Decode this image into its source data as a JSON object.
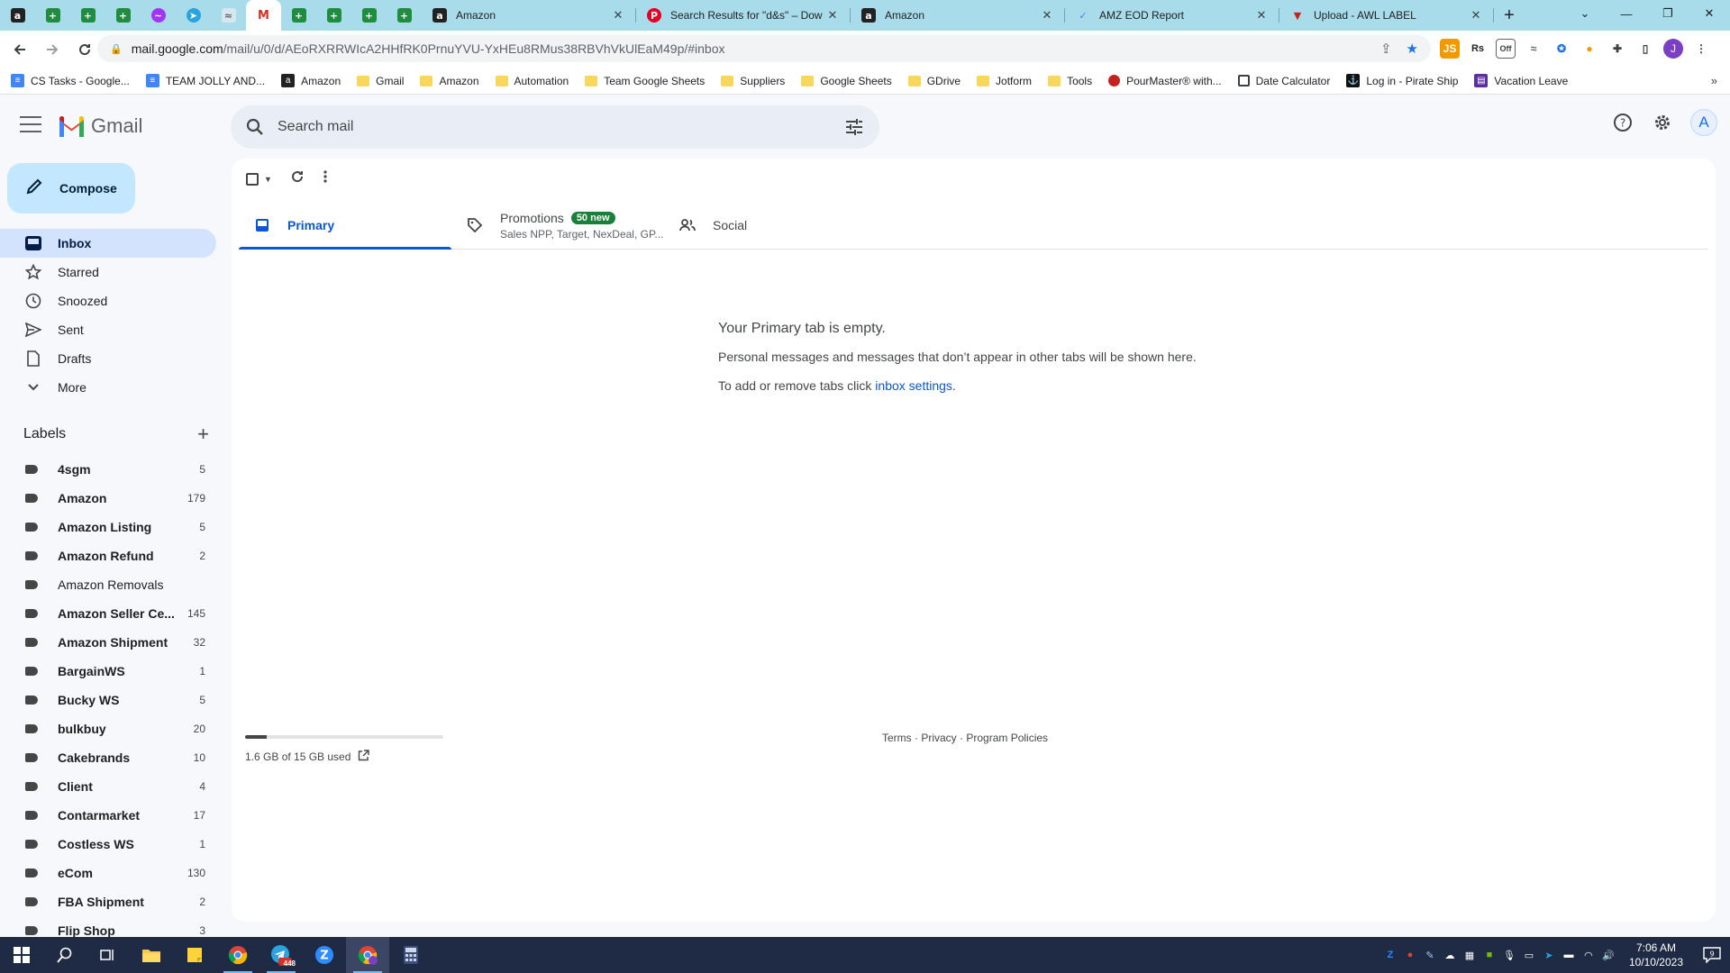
{
  "browser": {
    "pinned_tabs": [
      {
        "icon": "amazon-icon",
        "glyph": "a"
      },
      {
        "icon": "sheets-icon",
        "glyph": "+"
      },
      {
        "icon": "sheets-icon",
        "glyph": "+"
      },
      {
        "icon": "sheets-icon",
        "glyph": "+"
      },
      {
        "icon": "messenger-icon",
        "glyph": "~"
      },
      {
        "icon": "telegram-icon",
        "glyph": "➤"
      },
      {
        "icon": "misc-icon",
        "glyph": "≈"
      },
      {
        "icon": "gmail-icon",
        "glyph": "M"
      },
      {
        "icon": "sheets-icon",
        "glyph": "+"
      },
      {
        "icon": "sheets-icon",
        "glyph": "+"
      },
      {
        "icon": "sheets-icon",
        "glyph": "+"
      },
      {
        "icon": "sheets-icon",
        "glyph": "+"
      }
    ],
    "tabs": [
      {
        "title": "Amazon",
        "icon": "amazon-icon",
        "glyph": "a"
      },
      {
        "title": "Search Results for \"d&s\" – Dow",
        "icon": "pinterest-icon",
        "glyph": "P"
      },
      {
        "title": "Amazon",
        "icon": "amazon-icon",
        "glyph": "a"
      },
      {
        "title": "AMZ EOD Report",
        "icon": "report-icon",
        "glyph": "✓"
      },
      {
        "title": "Upload - AWL LABEL",
        "icon": "awl-icon",
        "glyph": "▼"
      }
    ],
    "close_glyph": "✕",
    "newtab_glyph": "+",
    "url_host": "mail.google.com",
    "url_path": "/mail/u/0/d/AEoRXRRWIcA2HHfRK0PrnuYVU-YxHEu8RMus38RBVhVkUlEaM49p/#inbox",
    "profile_initial": "J",
    "bookmarks": [
      {
        "label": "CS Tasks - Google...",
        "icon": "doc"
      },
      {
        "label": "TEAM JOLLY AND...",
        "icon": "doc"
      },
      {
        "label": "Amazon",
        "icon": "amz"
      },
      {
        "label": "Gmail",
        "icon": "folder"
      },
      {
        "label": "Amazon",
        "icon": "folder"
      },
      {
        "label": "Automation",
        "icon": "folder"
      },
      {
        "label": "Team Google Sheets",
        "icon": "folder"
      },
      {
        "label": "Suppliers",
        "icon": "folder"
      },
      {
        "label": "Google Sheets",
        "icon": "folder"
      },
      {
        "label": "GDrive",
        "icon": "folder"
      },
      {
        "label": "Jotform",
        "icon": "folder"
      },
      {
        "label": "Tools",
        "icon": "folder"
      },
      {
        "label": "PourMaster® with...",
        "icon": "red"
      },
      {
        "label": "Date Calculator",
        "icon": "cal"
      },
      {
        "label": "Log in - Pirate Ship",
        "icon": "pirate"
      },
      {
        "label": "Vacation Leave",
        "icon": "purple"
      }
    ]
  },
  "gmail": {
    "logo_text": "Gmail",
    "search_placeholder": "Search mail",
    "avatar_initial": "A",
    "compose_label": "Compose",
    "nav": [
      {
        "label": "Inbox",
        "icon": "inbox-icon",
        "active": true
      },
      {
        "label": "Starred",
        "icon": "star-icon"
      },
      {
        "label": "Snoozed",
        "icon": "clock-icon"
      },
      {
        "label": "Sent",
        "icon": "send-icon"
      },
      {
        "label": "Drafts",
        "icon": "draft-icon"
      },
      {
        "label": "More",
        "icon": "chevron-down-icon"
      }
    ],
    "labels_title": "Labels",
    "labels": [
      {
        "name": "4sgm",
        "count": "5",
        "bold": true
      },
      {
        "name": "Amazon",
        "count": "179",
        "bold": true
      },
      {
        "name": "Amazon Listing",
        "count": "5",
        "bold": true
      },
      {
        "name": "Amazon Refund",
        "count": "2",
        "bold": true
      },
      {
        "name": "Amazon Removals",
        "count": "",
        "bold": false
      },
      {
        "name": "Amazon Seller Ce...",
        "count": "145",
        "bold": true
      },
      {
        "name": "Amazon Shipment",
        "count": "32",
        "bold": true
      },
      {
        "name": "BargainWS",
        "count": "1",
        "bold": true
      },
      {
        "name": "Bucky WS",
        "count": "5",
        "bold": true
      },
      {
        "name": "bulkbuy",
        "count": "20",
        "bold": true
      },
      {
        "name": "Cakebrands",
        "count": "10",
        "bold": true
      },
      {
        "name": "Client",
        "count": "4",
        "bold": true
      },
      {
        "name": "Contarmarket",
        "count": "17",
        "bold": true
      },
      {
        "name": "Costless WS",
        "count": "1",
        "bold": true
      },
      {
        "name": "eCom",
        "count": "130",
        "bold": true
      },
      {
        "name": "FBA Shipment",
        "count": "2",
        "bold": true
      },
      {
        "name": "Flip Shop",
        "count": "3",
        "bold": true
      }
    ],
    "tabs": {
      "primary": "Primary",
      "promotions": "Promotions",
      "promotions_badge": "50 new",
      "promotions_sub": "Sales NPP, Target, NexDeal, GP...",
      "social": "Social"
    },
    "empty": {
      "heading": "Your Primary tab is empty.",
      "line1": "Personal messages and messages that don’t appear in other tabs will be shown here.",
      "line2_prefix": "To add or remove tabs click ",
      "line2_link": "inbox settings",
      "line2_suffix": "."
    },
    "storage": {
      "text": "1.6 GB of 15 GB used",
      "used_fraction": 0.107
    },
    "footer": {
      "terms": "Terms",
      "privacy": "Privacy",
      "policies": "Program Policies",
      "sep": " · "
    }
  },
  "taskbar": {
    "time": "7:06 AM",
    "date": "10/10/2023",
    "telegram_badge": "448",
    "notif_count": "9"
  }
}
